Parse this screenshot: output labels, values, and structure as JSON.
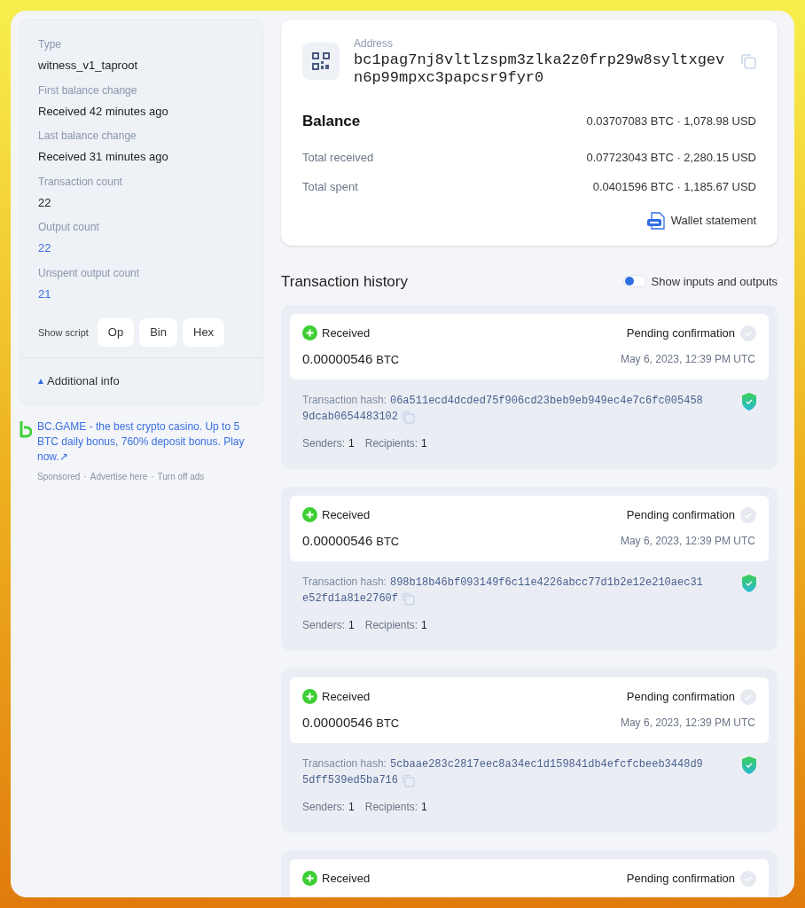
{
  "details": [
    {
      "label": "Type",
      "value": "witness_v1_taproot",
      "kind": "text"
    },
    {
      "label": "First balance change",
      "value": "Received 42 minutes ago",
      "kind": "text"
    },
    {
      "label": "Last balance change",
      "value": "Received 31 minutes ago",
      "kind": "text"
    },
    {
      "label": "Transaction count",
      "value": "22",
      "kind": "text"
    },
    {
      "label": "Output count",
      "value": "22",
      "kind": "link"
    },
    {
      "label": "Unspent output count",
      "value": "21",
      "kind": "link"
    }
  ],
  "show_script": {
    "label": "Show script",
    "buttons": [
      "Op",
      "Bin",
      "Hex"
    ]
  },
  "additional_info": {
    "label": "Additional info",
    "expanded": true
  },
  "ad": {
    "text": "BC.GAME - the best crypto casino. Up to 5 BTC daily bonus, 760% deposit bonus. Play now.↗",
    "sponsored": "Sponsored",
    "separator": "·",
    "links": [
      "Advertise here",
      "Turn off ads"
    ]
  },
  "address": {
    "label": "Address",
    "value": "bc1pag7nj8vltlzspm3zlka2z0frp29w8syltxgevn6p99mpxc3papcsr9fyr0"
  },
  "balance": {
    "label": "Balance",
    "btc": "0.03707083 BTC",
    "separator": "·",
    "usd": "1,078.98 USD"
  },
  "totals": [
    {
      "label": "Total received",
      "btc": "0.07723043 BTC",
      "separator": "·",
      "usd": "2,280.15 USD"
    },
    {
      "label": "Total spent",
      "btc": "0.0401596 BTC",
      "separator": "·",
      "usd": "1,185.67 USD"
    }
  ],
  "wallet_statement": "Wallet statement",
  "history": {
    "title": "Transaction history",
    "toggle": {
      "label": "Show inputs and outputs",
      "on": false
    },
    "transactions": [
      {
        "direction": "Received",
        "amount": "0.00000546",
        "unit": "BTC",
        "status": "Pending confirmation",
        "date": "May 6, 2023, 12:39 PM UTC",
        "hash_label": "Transaction hash:",
        "hash_lines": [
          "06a511ecd4dcded75f906cd23beb9eb949ec4e7c6fc005458",
          "9dcab0654483102"
        ],
        "senders_label": "Senders:",
        "senders": "1",
        "recipients_label": "Recipients:",
        "recipients": "1"
      },
      {
        "direction": "Received",
        "amount": "0.00000546",
        "unit": "BTC",
        "status": "Pending confirmation",
        "date": "May 6, 2023, 12:39 PM UTC",
        "hash_label": "Transaction hash:",
        "hash_lines": [
          "898b18b46bf093149f6c11e4226abcc77d1b2e12e210aec31",
          "e52fd1a81e2760f"
        ],
        "senders_label": "Senders:",
        "senders": "1",
        "recipients_label": "Recipients:",
        "recipients": "1"
      },
      {
        "direction": "Received",
        "amount": "0.00000546",
        "unit": "BTC",
        "status": "Pending confirmation",
        "date": "May 6, 2023, 12:39 PM UTC",
        "hash_label": "Transaction hash:",
        "hash_lines": [
          "5cbaae283c2817eec8a34ec1d159841db4efcfcbeeb3448d9",
          "5dff539ed5ba716"
        ],
        "senders_label": "Senders:",
        "senders": "1",
        "recipients_label": "Recipients:",
        "recipients": "1"
      },
      {
        "direction": "Received",
        "status": "Pending confirmation"
      }
    ]
  }
}
